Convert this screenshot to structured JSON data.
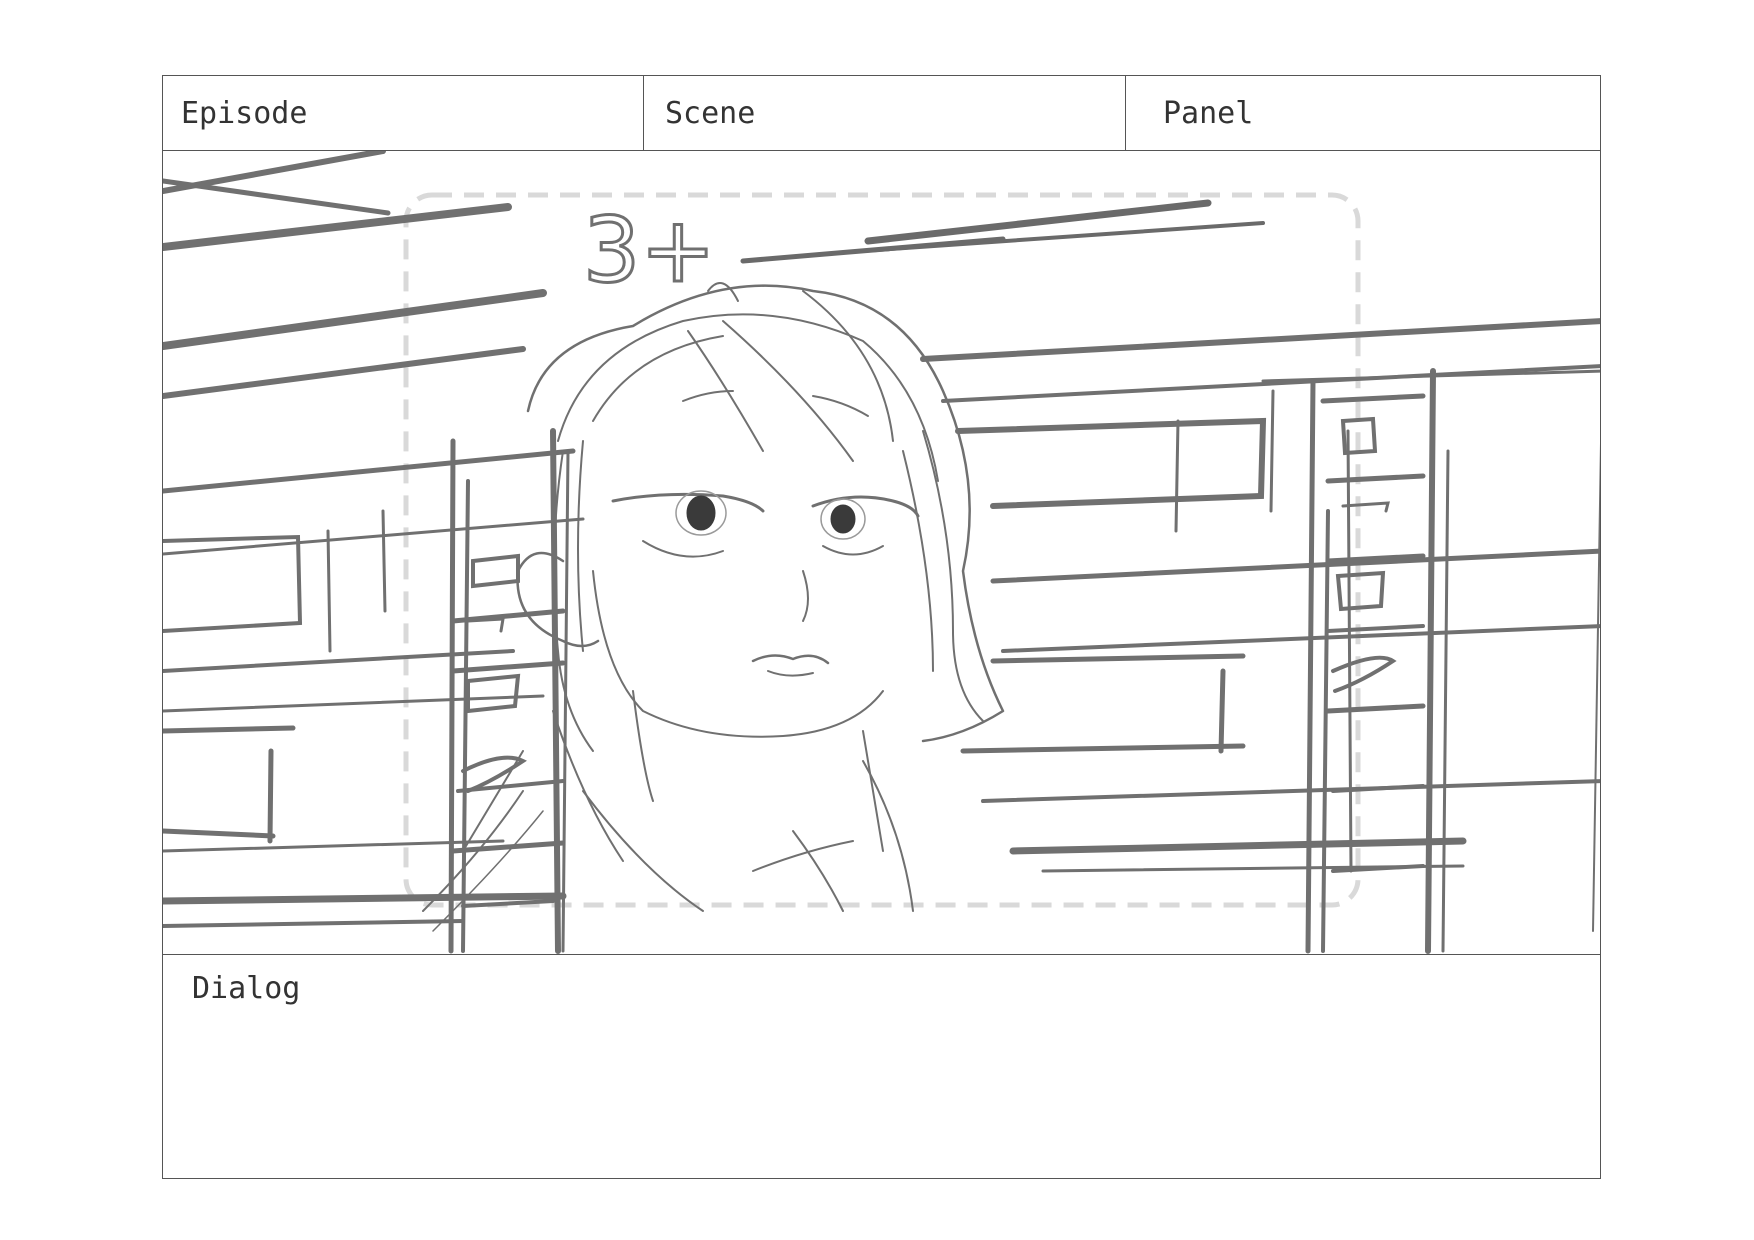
{
  "header": {
    "episode_label": "Episode",
    "scene_label": "Scene",
    "panel_label": "Panel"
  },
  "frame": {
    "sketch_text": "3+"
  },
  "dialog": {
    "label": "Dialog"
  },
  "colors": {
    "border": "#555555",
    "sketch_dark": "#6e6e6e",
    "sketch_light": "#8a8a8a",
    "safe_area": "#d9d9d9"
  }
}
